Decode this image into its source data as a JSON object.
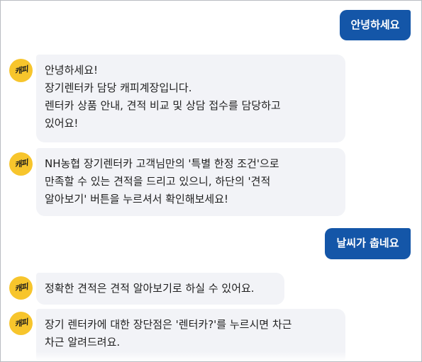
{
  "messages": {
    "user1": "안녕하세요",
    "bot1": {
      "avatar_text": "캐피",
      "lines": [
        "안녕하세요!",
        "장기렌터카 담당 캐피계장입니다.",
        "렌터카 상품 안내, 견적 비교 및 상담 접수를 담당하고",
        "있어요!"
      ]
    },
    "bot2": {
      "avatar_text": "캐피",
      "lines": [
        "NH농협 장기렌터카 고객님만의 '특별 한정 조건'으로",
        "만족할 수 있는 견적을 드리고 있으니, 하단의 '견적",
        "알아보기' 버튼을 누르셔서 확인해보세요!"
      ]
    },
    "user2": "날씨가 춥네요",
    "bot3": {
      "avatar_text": "캐피",
      "lines": [
        "정확한 견적은 견적 알아보기로 하실 수 있어요."
      ]
    },
    "bot4": {
      "avatar_text": "캐피",
      "lines": [
        "장기 렌터카에 대한 장단점은 '렌터카?'를 누르시면 차근",
        "차근 알려드려요."
      ]
    }
  },
  "colors": {
    "user_bubble": "#1456a8",
    "bot_bubble": "#f2f3f7",
    "avatar": "#f7c52c"
  }
}
